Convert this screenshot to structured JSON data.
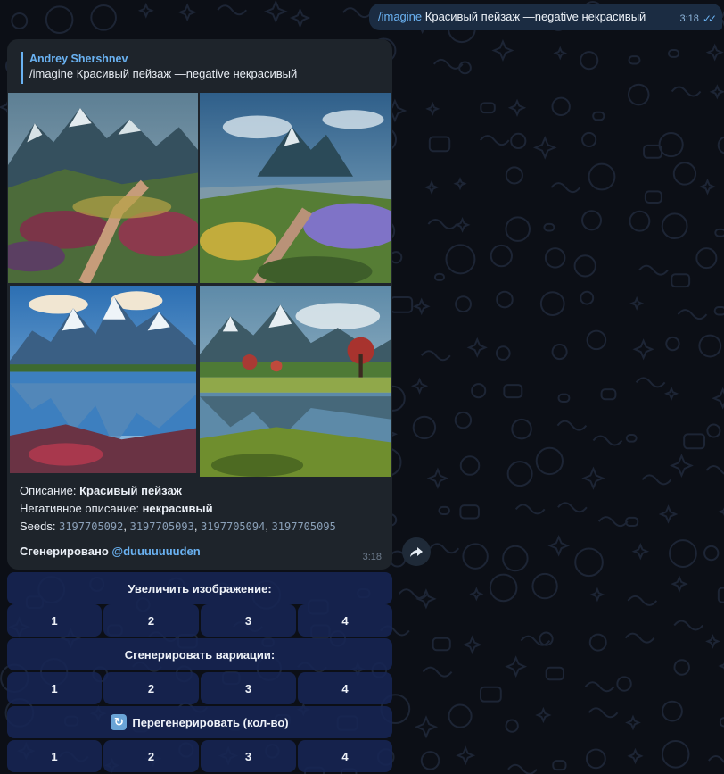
{
  "outgoing": {
    "command": "/imagine",
    "text": "Красивый пейзаж —negative некрасивый",
    "time": "3:18"
  },
  "incoming": {
    "reply_author": "Andrey Shershnev",
    "reply_text": "/imagine Красивый пейзаж —negative некрасивый",
    "images": [
      {
        "icon": "mountain-meadow-landscape"
      },
      {
        "icon": "mountain-valley-flowers-landscape"
      },
      {
        "icon": "mountain-lake-reflection-landscape"
      },
      {
        "icon": "mountain-lake-trees-landscape"
      }
    ],
    "description_label": "Описание:",
    "description_value": "Красивый пейзаж",
    "negative_label": "Негативное описание:",
    "negative_value": "некрасивый",
    "seeds_label": "Seeds:",
    "seeds": [
      "3197705092",
      "3197705093",
      "3197705094",
      "3197705095"
    ],
    "generated_label": "Сгенерировано",
    "generated_by": "@duuuuuuuden",
    "time": "3:18"
  },
  "keyboard": {
    "upscale_label": "Увеличить изображение:",
    "upscale_buttons": [
      "1",
      "2",
      "3",
      "4"
    ],
    "variations_label": "Сгенерировать вариации:",
    "variations_buttons": [
      "1",
      "2",
      "3",
      "4"
    ],
    "regenerate_label": "Перегенерировать (кол-во)",
    "regenerate_buttons": [
      "1",
      "2",
      "3",
      "4"
    ]
  },
  "colors": {
    "accent": "#6ab2f2",
    "bubble_in": "#1e242b",
    "bubble_out": "#1b2c42",
    "keyboard_button": "#172654"
  }
}
